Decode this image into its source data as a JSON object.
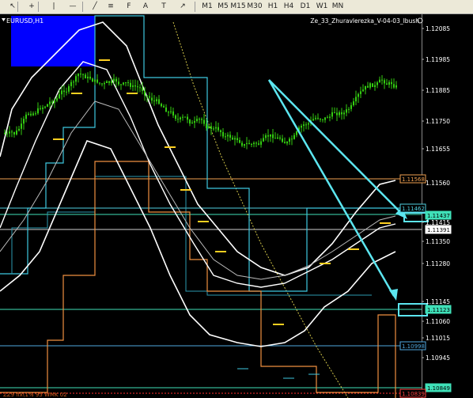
{
  "toolbar": {
    "tools": [
      {
        "name": "cursor-icon",
        "glyph": "↖"
      },
      {
        "name": "crosshair-icon",
        "glyph": "+"
      },
      {
        "name": "vertical-line-icon",
        "glyph": "|"
      },
      {
        "name": "horizontal-line-icon",
        "glyph": "—"
      },
      {
        "name": "trendline-icon",
        "glyph": "╱"
      },
      {
        "name": "equidistant-channel-icon",
        "glyph": "≡"
      },
      {
        "name": "fibonacci-icon",
        "glyph": "F"
      },
      {
        "name": "text-icon",
        "glyph": "A"
      },
      {
        "name": "text-label-icon",
        "glyph": "T"
      },
      {
        "name": "arrow-icon",
        "glyph": "↗"
      }
    ],
    "periods": [
      "M1",
      "M5",
      "M15",
      "M30",
      "H1",
      "H4",
      "D1",
      "W1",
      "MN"
    ]
  },
  "chart": {
    "symbol_label": "EURUSD,H1",
    "indicator_label": "Ze_33_Zhuravlerezka_V-04-03_Ibush",
    "bottom_label": "ZZ9 fix(1% 95 WMK 02",
    "price_ticks": [
      "1.12085",
      "1.11985",
      "1.11885",
      "1.11750",
      "1.11655",
      "1.11560",
      "1.11415",
      "1.11350",
      "1.11280",
      "1.11145",
      "1.11060",
      "1.11015",
      "1.10945"
    ],
    "price_levels": [
      {
        "value": "1.11568",
        "color": "#f0a050"
      },
      {
        "value": "1.11462",
        "color": "#4fd0e0"
      },
      {
        "value": "1.11437",
        "color": "#3fe0b8"
      },
      {
        "value": "1.11391",
        "color": "#ffffff"
      },
      {
        "value": "1.11123",
        "color": "#3fe0b8"
      },
      {
        "value": "1.10998",
        "color": "#4fa8e0"
      },
      {
        "value": "1.10849",
        "color": "#3fe0b8"
      },
      {
        "value": "1.10839",
        "color": "#ff4040"
      }
    ],
    "colors": {
      "candles": "#33cc11",
      "bands": "#ffffff",
      "channel": "#3ec8e0",
      "orange_line": "#f09040",
      "arrows": "#5ce6f0",
      "blue_box": "#0000ff"
    }
  }
}
